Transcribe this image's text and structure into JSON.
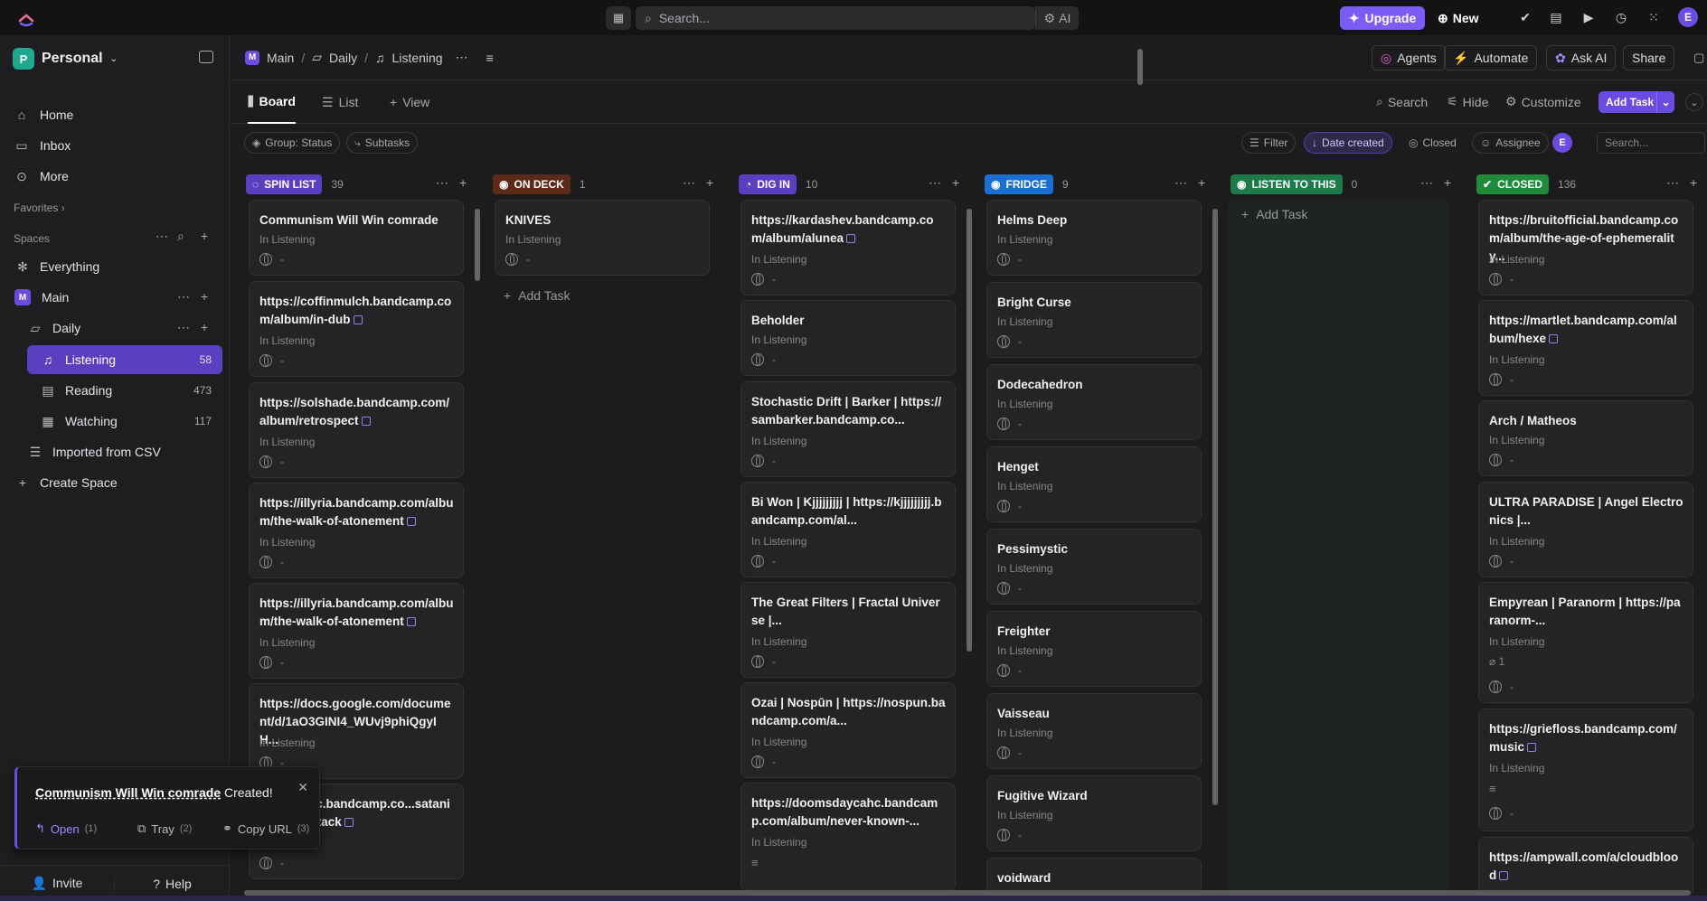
{
  "topbar": {
    "search_placeholder": "Search...",
    "ai_label": "AI",
    "upgrade_label": "Upgrade",
    "new_label": "New",
    "user_initial": "E"
  },
  "sidebar": {
    "workspace_initial": "P",
    "workspace_name": "Personal",
    "nav": [
      {
        "label": "Home",
        "icon": "home-icon"
      },
      {
        "label": "Inbox",
        "icon": "inbox-icon"
      },
      {
        "label": "More",
        "icon": "more-icon"
      }
    ],
    "favorites_label": "Favorites",
    "spaces_label": "Spaces",
    "everything_label": "Everything",
    "main_space": {
      "initial": "M",
      "label": "Main"
    },
    "daily_label": "Daily",
    "lists": [
      {
        "label": "Listening",
        "count": "58"
      },
      {
        "label": "Reading",
        "count": "473"
      },
      {
        "label": "Watching",
        "count": "117"
      }
    ],
    "imported_label": "Imported from CSV",
    "create_space_label": "Create Space",
    "invite_label": "Invite",
    "help_label": "Help"
  },
  "header": {
    "crumbs": [
      "Main",
      "Daily",
      "Listening"
    ],
    "agents_label": "Agents",
    "automate_label": "Automate",
    "ask_ai_label": "Ask AI",
    "share_label": "Share"
  },
  "views": {
    "board_label": "Board",
    "list_label": "List",
    "add_view_label": "View",
    "search_label": "Search",
    "hide_label": "Hide",
    "customize_label": "Customize",
    "add_task_label": "Add Task"
  },
  "filters": {
    "group_label": "Group: Status",
    "subtasks_label": "Subtasks",
    "filter_label": "Filter",
    "date_label": "Date created",
    "closed_label": "Closed",
    "assignee_label": "Assignee",
    "assignee_initial": "E",
    "search_placeholder": "Search..."
  },
  "board": {
    "sub_label": "In Listening",
    "dash": "-",
    "add_task_label": "Add Task",
    "columns": [
      {
        "name": "SPIN LIST",
        "count": "39",
        "color": "#6a4ce0",
        "cards": [
          "Communism Will Win comrade",
          "https://coffinmulch.bandcamp.com/album/in-dub",
          "https://solshade.bandcamp.com/album/retrospect",
          "https://illyria.bandcamp.com/album/the-walk-of-atonement",
          "https://illyria.bandcamp.com/album/the-walk-of-atonement",
          "https://docs.google.com/document/d/1aO3GINI4_WUvj9phiQgyIH...",
          "...plemusic.bandcamp.co...satanic-panic-attack"
        ]
      },
      {
        "name": "ON DECK",
        "count": "1",
        "color": "#8a3a1a",
        "cards": [
          "KNIVES"
        ]
      },
      {
        "name": "DIG IN",
        "count": "10",
        "color": "#6a4ce0",
        "cards": [
          "https://kardashev.bandcamp.com/album/alunea",
          "Beholder",
          "Stochastic Drift | Barker | https://sambarker.bandcamp.co...",
          "Bi Won | Kjjjjjjjjj | https://kjjjjjjjjj.bandcamp.com/al...",
          "The Great Filters | Fractal Universe |...",
          "Ozai | Nospūn | https://nospun.bandcamp.com/a...",
          "https://doomsdaycahc.bandcamp.com/album/never-known-..."
        ]
      },
      {
        "name": "FRIDGE",
        "count": "9",
        "color": "#1a74d6",
        "cards": [
          "Helms Deep",
          "Bright Curse",
          "Dodecahedron",
          "Henget",
          "Pessimystic",
          "Freighter",
          "Vaisseau",
          "Fugitive Wizard",
          "voidward"
        ]
      },
      {
        "name": "LISTEN TO THIS",
        "count": "0",
        "color": "#1f8a55",
        "cards": []
      },
      {
        "name": "CLOSED",
        "count": "136",
        "color": "#1f8a3a",
        "cards": [
          "https://bruitofficial.bandcamp.com/album/the-age-of-ephemerality...",
          "https://martlet.bandcamp.com/album/hexe",
          "Arch / Matheos",
          "ULTRA PARADISE | Angel Electronics |...",
          "Empyrean | Paranorm | https://paranorm-...",
          "https://griefloss.bandcamp.com/music",
          "https://ampwall.com/a/cloudblood"
        ],
        "attachment_count": "1"
      }
    ]
  },
  "toast": {
    "task_name": "Communism Will Win comrade",
    "suffix": "Created!",
    "open_label": "Open",
    "open_key": "(1)",
    "tray_label": "Tray",
    "tray_key": "(2)",
    "copy_label": "Copy URL",
    "copy_key": "(3)"
  }
}
